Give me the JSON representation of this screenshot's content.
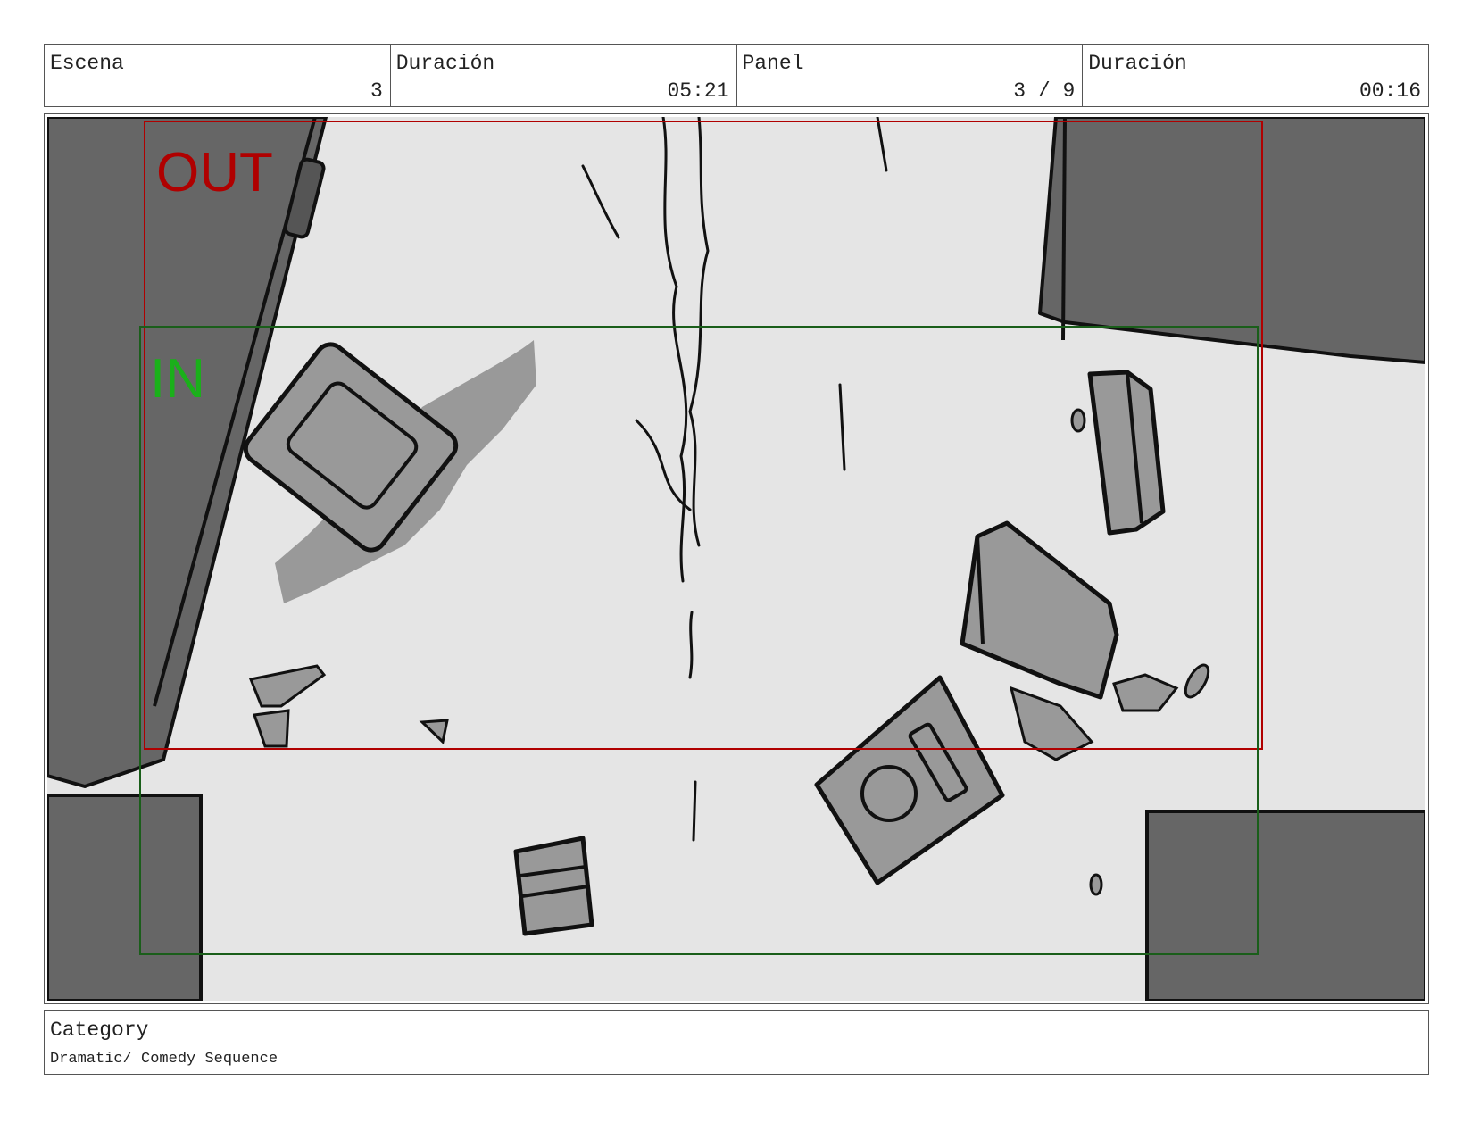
{
  "header": {
    "scene": {
      "label": "Escena",
      "value": "3"
    },
    "scene_duration": {
      "label": "Duración",
      "value": "05:21"
    },
    "panel": {
      "label": "Panel",
      "value": "3 / 9"
    },
    "panel_duration": {
      "label": "Duración",
      "value": "00:16"
    }
  },
  "frame_guides": {
    "out_label": "OUT",
    "in_label": "IN",
    "out_color": "#b00000",
    "in_color": "#1a8a1a"
  },
  "footer": {
    "category_label": "Category",
    "category_value": "Dramatic/ Comedy Sequence"
  }
}
